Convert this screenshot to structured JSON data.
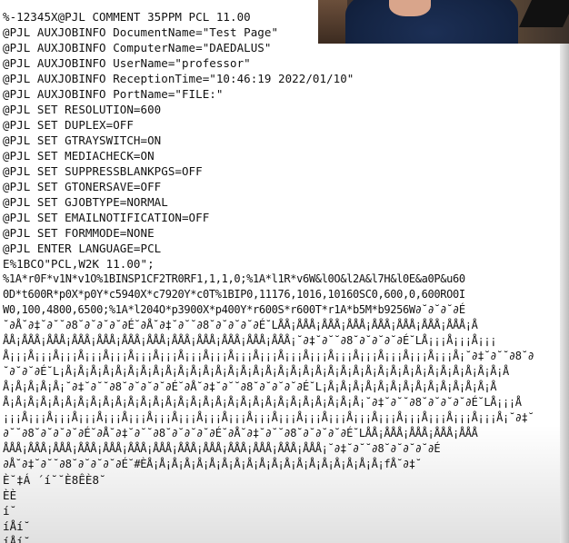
{
  "window_title": "",
  "print_job_listing": {
    "lines": [
      "%-12345X@PJL COMMENT 35PPM PCL 11.00",
      "@PJL AUXJOBINFO DocumentName=\"Test Page\"",
      "@PJL AUXJOBINFO ComputerName=\"DAEDALUS\"",
      "@PJL AUXJOBINFO UserName=\"professor\"",
      "@PJL AUXJOBINFO ReceptionTime=\"10:46:19 2022/01/10\"",
      "@PJL AUXJOBINFO PortName=\"FILE:\"",
      "@PJL SET RESOLUTION=600",
      "@PJL SET DUPLEX=OFF",
      "@PJL SET GTRAYSWITCH=ON",
      "@PJL SET MEDIACHECK=ON",
      "@PJL SET SUPPRESSBLANKPGS=OFF",
      "@PJL SET GTONERSAVE=OFF",
      "@PJL SET GJOBTYPE=NORMAL",
      "@PJL SET EMAILNOTIFICATION=OFF",
      "@PJL SET FORMMODE=NONE",
      "@PJL ENTER LANGUAGE=PCL",
      "E%1BCO\"PCL,W2K 11.00\";",
      "%1A*r0F*v1N*v1O%1BINSP1CF2TR0RF1,1,1,0;%1A*l1R*v6W&l0O&l2A&l7H&l0E&a0P&u60",
      "0D*t600R*p0X*p0Y*c5940X*c7920Y*c0T%1BIP0,11176,1016,10160SC0,600,0,600RO0I",
      "W0,100,4800,6500;%1A*l204O*p3900X*p400Y*r600S*r600T*r1A*b5M*b9256W∂˘∂˘∂˘∂É",
      "˘∂Å˘∂‡˘∂˘˘∂8˘∂˘∂˘∂˘∂É˘∂Å˘∂‡˘∂˘˘∂8˘∂˘∂˘∂˘∂É˘LÅÅ¡ÅÅÅ¡ÅÅÅ¡ÅÅÅ¡ÅÅÅ¡ÅÅÅ¡ÅÅÅ¡ÅÅÅ¡Å",
      "ÅÅ¡ÅÅÅ¡ÅÅÅ¡ÅÅÅ¡ÅÅÅ¡ÅÅÅ¡ÅÅÅ¡ÅÅÅ¡ÅÅÅ¡ÅÅÅ¡ÅÅÅ¡ÅÅÅ¡˘∂‡˘∂˘˘∂8˘∂˘∂˘∂˘∂É˘LÅ¡¡¡Å¡¡¡Å¡¡¡",
      "Å¡¡¡Å¡¡¡Å¡¡¡Å¡¡¡Å¡¡¡Å¡¡¡Å¡¡¡Å¡¡¡Å¡¡¡Å¡¡¡Å¡¡¡Å¡¡¡Å¡¡¡Å¡¡¡Å¡¡¡Å¡¡¡Å¡¡¡Å¡¡¡Å¡˘∂‡˘∂˘˘∂8˘∂",
      "˘∂˘∂˘∂É˘L¡Å¡Å¡Å¡Å¡Å¡Å¡Å¡Å¡Å¡Å¡Å¡Å¡Å¡Å¡Å¡Å¡Å¡Å¡Å¡Å¡Å¡Å¡Å¡Å¡Å¡Å¡Å¡Å¡Å¡Å¡Å¡Å¡Å¡Å¡Å¡Å",
      "Å¡Å¡Å¡Å¡Å¡˘∂‡˘∂˘˘∂8˘∂˘∂˘∂˘∂É˘∂Å˘∂‡˘∂˘˘∂8˘∂˘∂˘∂˘∂É˘L¡Å¡Å¡Å¡Å¡Å¡Å¡Å¡Å¡Å¡Å¡Å¡Å¡Å¡Å",
      "Å¡Å¡Å¡Å¡Å¡Å¡Å¡Å¡Å¡Å¡Å¡Å¡Å¡Å¡Å¡Å¡Å¡Å¡Å¡Å¡Å¡Å¡Å¡Å¡Å¡Å¡Å¡Å¡Å¡˘∂‡˘∂˘˘∂8˘∂˘∂˘∂˘∂É˘LÅ¡¡¡Å",
      "¡¡¡Å¡¡¡Å¡¡¡Å¡¡¡Å¡¡¡Å¡¡¡Å¡¡¡Å¡¡¡Å¡¡¡Å¡¡¡Å¡¡¡Å¡¡¡Å¡¡¡Å¡¡¡Å¡¡¡Å¡¡¡Å¡¡¡Å¡¡¡Å¡¡¡Å¡¡¡Å¡˘∂‡˘",
      "∂˘˘∂8˘∂˘∂˘∂˘∂É˘∂Å˘∂‡˘∂˘˘∂8˘∂˘∂˘∂˘∂É˘∂Å˘∂‡˘∂˘˘∂8˘∂˘∂˘∂˘∂É˘LÅÅ¡ÅÅÅ¡ÅÅÅ¡ÅÅÅ¡ÅÅÅ",
      "ÅÅÅ¡ÅÅÅ¡ÅÅÅ¡ÅÅÅ¡ÅÅÅ¡ÅÅÅ¡ÅÅÅ¡ÅÅÅ¡ÅÅÅ¡ÅÅÅ¡ÅÅÅ¡ÅÅÅ¡ÅÅÅ¡˘∂‡˘∂˘˘∂8˘∂˘∂˘∂˘∂É",
      "∂Å˘∂‡˘∂˘˘∂8˘∂˘∂˘∂˘∂É˘#ÈÅ¡Å¡Å¡Å¡Å¡Å¡Å¡Å¡Å¡Å¡Å¡Å¡Å¡Å¡Å¡Å¡Å¡Å¡Å¡fÅ˘∂‡˘",
      "È˘‡Á ´í˘˘È8ÊÈ8˘",
      "ÈÈ",
      "í˘",
      "íÅí˘",
      "íÅí˘"
    ]
  }
}
